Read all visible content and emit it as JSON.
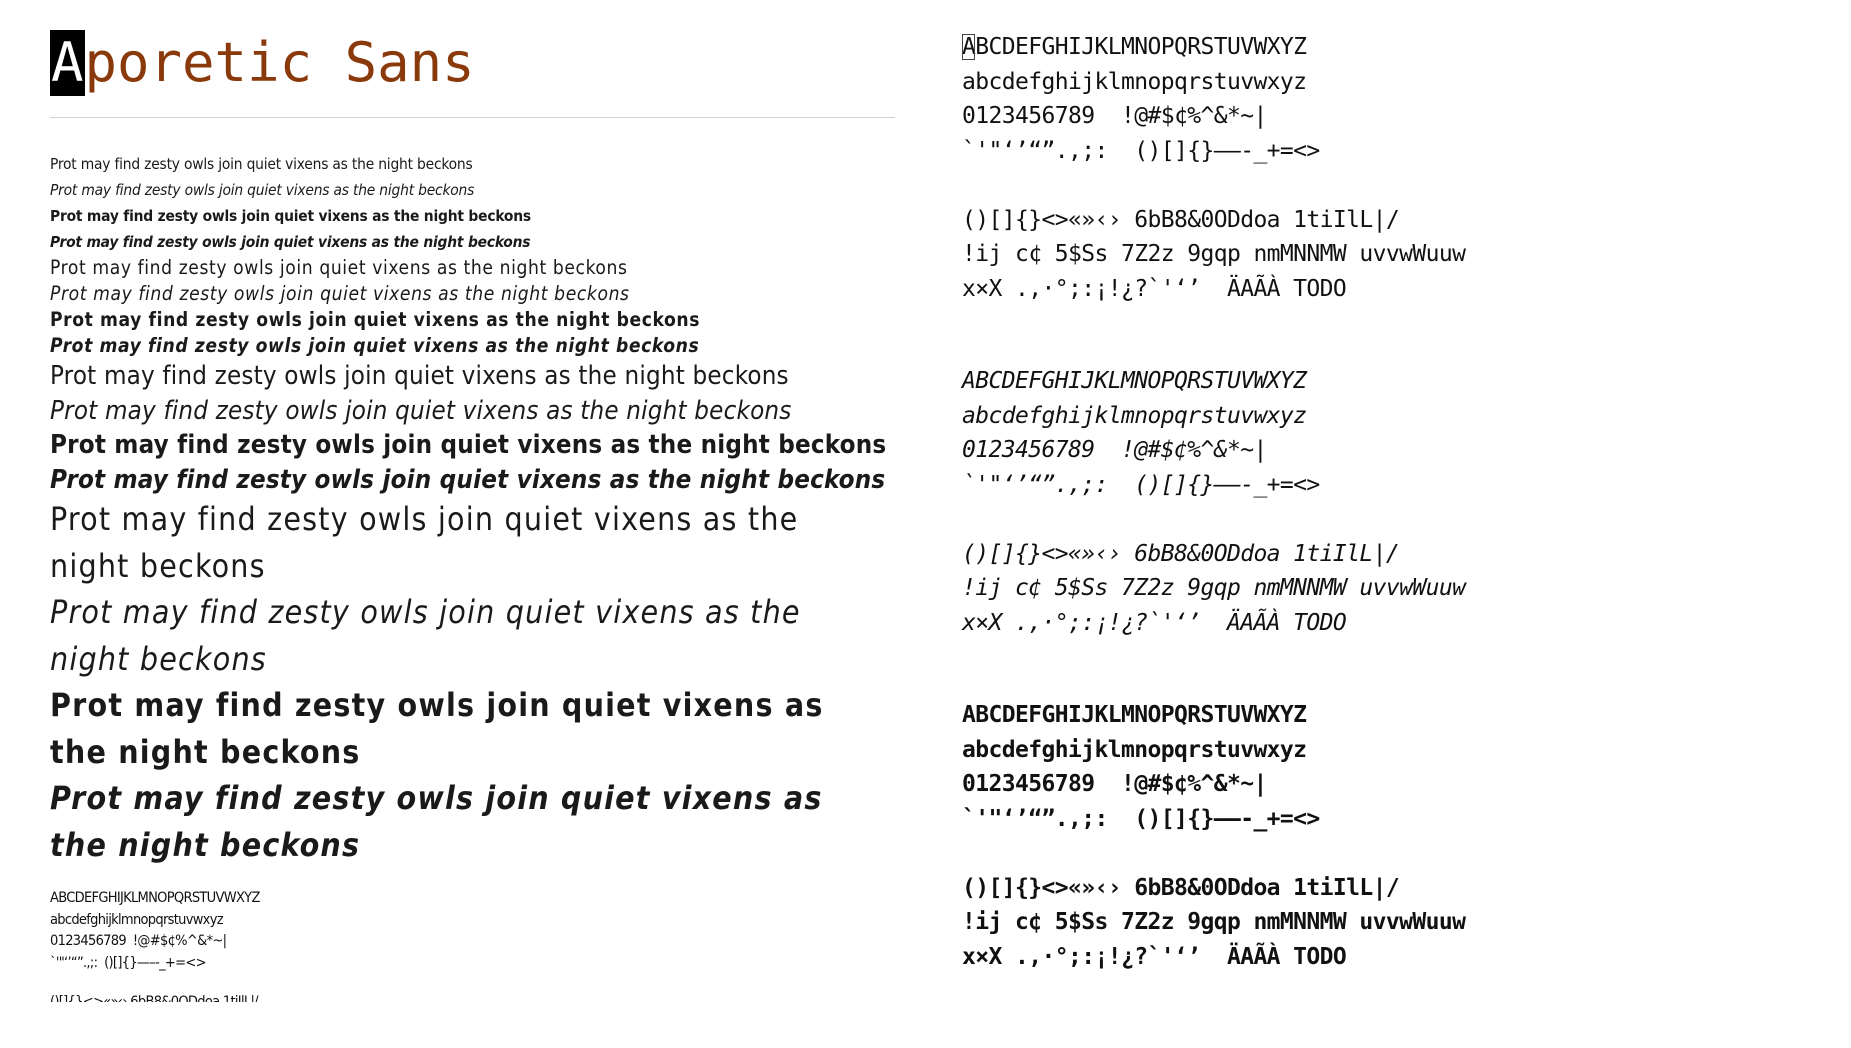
{
  "title": {
    "first": "A",
    "rest": "poretic Sans"
  },
  "pangram": "Prot may find zesty owls join quiet vixens as the night beckons",
  "charset": {
    "line1": "ABCDEFGHIJKLMNOPQRSTUVWXYZ",
    "line1_first": "A",
    "line1_rest": "BCDEFGHIJKLMNOPQRSTUVWXYZ",
    "line2": "abcdefghijklmnopqrstuvwxyz",
    "line3": "0123456789  !@#$¢%^&*~|",
    "line4": "`'\"‘’“”.,;:  ()[]{}—–-_+=<>",
    "line5": "()[]{}<>«»‹› 6bB8&0ODdoa 1tiIlL|/",
    "line6": "!ij c¢ 5$Ss 7Z2z 9gqp nmMNNMW uvvwWuuw",
    "line7": "x×X .,·°;:¡!¿?`'‘’  ÄAÃÀ TODO"
  },
  "colors": {
    "title": "#8a3a0a",
    "text": "#1a1a1a",
    "rule": "#d0d0d0",
    "cursor_bg": "#000000"
  }
}
